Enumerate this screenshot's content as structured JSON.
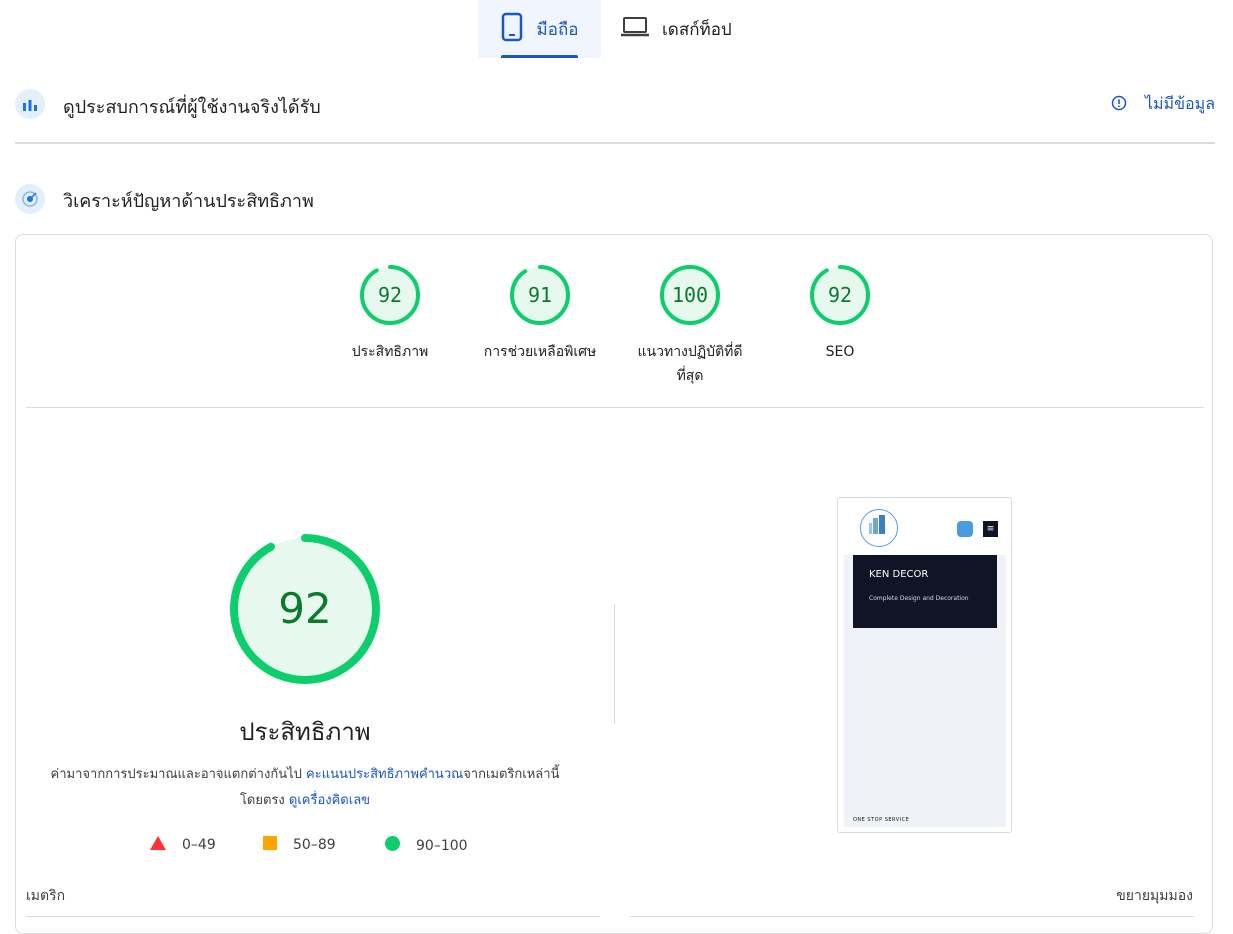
{
  "tabs": {
    "mobile_label": "มือถือ",
    "desktop_label": "เดสก์ท็อป"
  },
  "field_data": {
    "title": "ดูประสบการณ์ที่ผู้ใช้งานจริงได้รับ",
    "no_data": "ไม่มีข้อมูล"
  },
  "diagnose": {
    "title": "วิเคราะห์ปัญหาด้านประสิทธิภาพ"
  },
  "scores": [
    {
      "value": 92,
      "label": "ประสิทธิภาพ"
    },
    {
      "value": 91,
      "label": "การช่วยเหลือพิเศษ"
    },
    {
      "value": 100,
      "label": "แนวทางปฏิบัติที่ดีที่สุด"
    },
    {
      "value": 92,
      "label": "SEO"
    }
  ],
  "performance": {
    "value": 92,
    "title": "ประสิทธิภาพ",
    "desc_before": "ค่ามาจากการประมาณและอาจแตกต่างกันไป ",
    "desc_link1": "คะแนนประสิทธิภาพคำนวณ",
    "desc_middle": "จากเมตริกเหล่านี้โดยตรง ",
    "desc_link2": "ดูเครื่องคิดเลข"
  },
  "legend": {
    "fail": "0–49",
    "average": "50–89",
    "pass": "90–100"
  },
  "preview": {
    "hero_title": "KEN DECOR",
    "hero_subtitle": "Complete Design and Decoration",
    "footer": "ONE STOP SERVICE",
    "menu_glyph": "≡"
  },
  "metrics": {
    "label": "เมตริก",
    "expand": "ขยายมุมมอง"
  },
  "colors": {
    "accent": "#1a56c4",
    "pass": "#0cce6b",
    "average": "#ffa400",
    "fail": "#ff3333"
  }
}
